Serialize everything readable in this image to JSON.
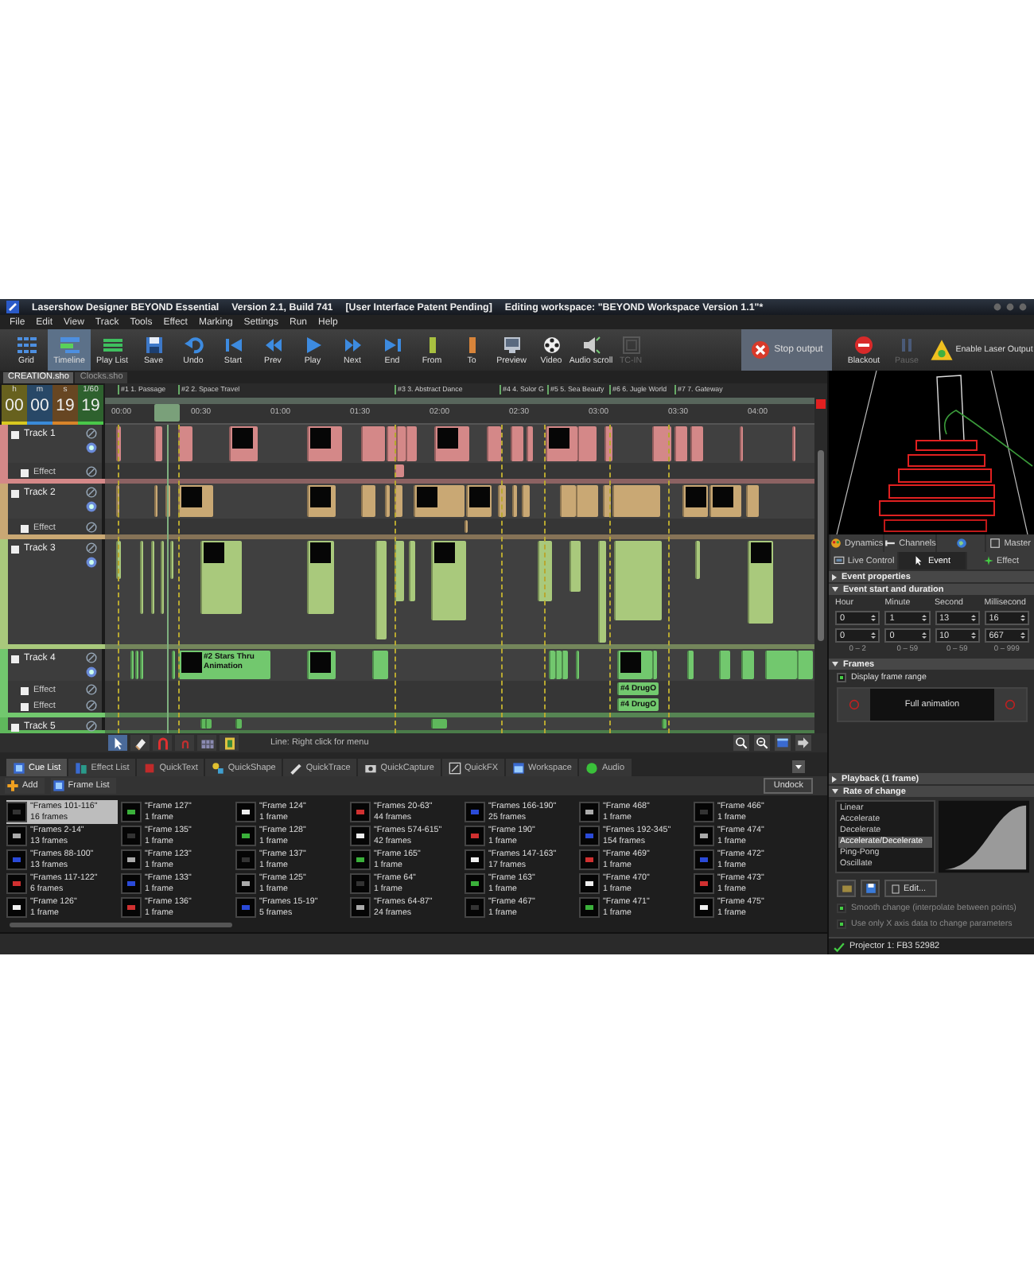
{
  "window": {
    "title": "Lasershow Designer BEYOND Essential",
    "version": "Version 2.1, Build 741",
    "patent": "[User Interface Patent Pending]",
    "workspace": "Editing workspace: \"BEYOND Workspace Version 1.1\"*"
  },
  "menu": [
    "File",
    "Edit",
    "View",
    "Track",
    "Tools",
    "Effect",
    "Marking",
    "Settings",
    "Run",
    "Help"
  ],
  "toolbar": {
    "views": [
      {
        "label": "Grid",
        "selected": false
      },
      {
        "label": "Timeline",
        "selected": true
      },
      {
        "label": "Play List",
        "selected": false
      }
    ],
    "commands": [
      {
        "label": "Save",
        "disabled": false
      },
      {
        "label": "Undo",
        "disabled": false
      },
      {
        "label": "Start",
        "disabled": false
      },
      {
        "label": "Prev",
        "disabled": false
      },
      {
        "label": "Play",
        "disabled": false
      },
      {
        "label": "Next",
        "disabled": false
      },
      {
        "label": "End",
        "disabled": false
      },
      {
        "label": "From",
        "disabled": false
      },
      {
        "label": "To",
        "disabled": false
      },
      {
        "label": "Preview",
        "disabled": false
      },
      {
        "label": "Video",
        "disabled": false
      },
      {
        "label": "Audio scroll",
        "disabled": false
      },
      {
        "label": "TC-IN",
        "disabled": true
      }
    ],
    "output": [
      {
        "kind": "stop",
        "label": "Stop output",
        "disabled": false
      },
      {
        "kind": "blackout",
        "label": "Blackout",
        "disabled": false
      },
      {
        "kind": "pause",
        "label": "Pause",
        "disabled": true
      },
      {
        "kind": "enable",
        "label": "Enable Laser Output",
        "disabled": false
      }
    ]
  },
  "file_tabs": [
    {
      "label": "CREATION.sho",
      "selected": true
    },
    {
      "label": "Clocks.sho",
      "selected": false
    }
  ],
  "timecode": [
    {
      "unit": "h",
      "value": "00",
      "color": "#d8c820"
    },
    {
      "unit": "m",
      "value": "00",
      "color": "#3a8ad8"
    },
    {
      "unit": "s",
      "value": "19",
      "color": "#d8842a"
    },
    {
      "unit": "1/60",
      "value": "19",
      "color": "#4ac84a"
    }
  ],
  "markers": [
    "#1 1. Passage",
    "#2 2. Space Travel",
    "#3 3. Abstract Dance",
    "#4 4. Solor G",
    "#5 5. Sea Beauty",
    "#6 6. Jugle World",
    "#7 7. Gateway"
  ],
  "ruler": [
    "00:00",
    "00:30",
    "01:00",
    "01:30",
    "02:00",
    "02:30",
    "03:00",
    "03:30",
    "04:00"
  ],
  "tracks": [
    {
      "name": "Track 1",
      "color": "#d48888",
      "effects": [
        {
          "name": "Effect"
        }
      ]
    },
    {
      "name": "Track 2",
      "color": "#c9a874",
      "effects": [
        {
          "name": "Effect"
        }
      ]
    },
    {
      "name": "Track 3",
      "color": "#a9c97c"
    },
    {
      "name": "Track 4",
      "color": "#72c86e",
      "clips": [
        {
          "label": "#2 Stars Thru Animation"
        }
      ],
      "effects": [
        {
          "name": "Effect",
          "clips": [
            {
              "label": "#4 DrugO"
            }
          ]
        },
        {
          "name": "Effect",
          "clips": [
            {
              "label": "#4 DrugO"
            }
          ]
        }
      ]
    },
    {
      "name": "Track 5",
      "color": "#5fb85c"
    }
  ],
  "timeline_tools": [
    {
      "selected": true
    },
    {
      "selected": false
    },
    {
      "selected": false
    },
    {
      "selected": false
    },
    {
      "selected": false
    },
    {
      "selected": false
    }
  ],
  "timeline_status": "Line: Right click for menu",
  "cue_panel": {
    "tabs": [
      {
        "label": "Cue List",
        "selected": true
      },
      {
        "label": "Effect List",
        "selected": false
      },
      {
        "label": "QuickText",
        "selected": false
      },
      {
        "label": "QuickShape",
        "selected": false
      },
      {
        "label": "QuickTrace",
        "selected": false
      },
      {
        "label": "QuickCapture",
        "selected": false
      },
      {
        "label": "QuickFX",
        "selected": false
      },
      {
        "label": "Workspace",
        "selected": false
      },
      {
        "label": "Audio",
        "selected": false
      }
    ],
    "actions": [
      "Add",
      "Frame List"
    ],
    "undock": "Undock",
    "cues": [
      {
        "name": "\"Frames 101-116\"",
        "frames": "16 frames",
        "selected": true
      },
      {
        "name": "\"Frames 2-14\"",
        "frames": "13 frames",
        "selected": false
      },
      {
        "name": "\"Frames 88-100\"",
        "frames": "13 frames",
        "selected": false
      },
      {
        "name": "\"Frames 117-122\"",
        "frames": "6 frames",
        "selected": false
      },
      {
        "name": "\"Frame 126\"",
        "frames": "1 frame",
        "selected": false
      },
      {
        "name": "\"Frame 127\"",
        "frames": "1 frame",
        "selected": false
      },
      {
        "name": "\"Frame 135\"",
        "frames": "1 frame",
        "selected": false
      },
      {
        "name": "\"Frame 123\"",
        "frames": "1 frame",
        "selected": false
      },
      {
        "name": "\"Frame 133\"",
        "frames": "1 frame",
        "selected": false
      },
      {
        "name": "\"Frame 136\"",
        "frames": "1 frame",
        "selected": false
      },
      {
        "name": "\"Frame 124\"",
        "frames": "1 frame",
        "selected": false
      },
      {
        "name": "\"Frame 128\"",
        "frames": "1 frame",
        "selected": false
      },
      {
        "name": "\"Frame 137\"",
        "frames": "1 frame",
        "selected": false
      },
      {
        "name": "\"Frame 125\"",
        "frames": "1 frame",
        "selected": false
      },
      {
        "name": "\"Frames 15-19\"",
        "frames": "5 frames",
        "selected": false
      },
      {
        "name": "\"Frames 20-63\"",
        "frames": "44 frames",
        "selected": false
      },
      {
        "name": "\"Frames 574-615\"",
        "frames": "42 frames",
        "selected": false
      },
      {
        "name": "\"Frame 165\"",
        "frames": "1 frame",
        "selected": false
      },
      {
        "name": "\"Frame 64\"",
        "frames": "1 frame",
        "selected": false
      },
      {
        "name": "\"Frames 64-87\"",
        "frames": "24 frames",
        "selected": false
      },
      {
        "name": "\"Frames 166-190\"",
        "frames": "25 frames",
        "selected": false
      },
      {
        "name": "\"Frame 190\"",
        "frames": "1 frame",
        "selected": false
      },
      {
        "name": "\"Frames 147-163\"",
        "frames": "17 frames",
        "selected": false
      },
      {
        "name": "\"Frame 163\"",
        "frames": "1 frame",
        "selected": false
      },
      {
        "name": "\"Frame 467\"",
        "frames": "1 frame",
        "selected": false
      },
      {
        "name": "\"Frame 468\"",
        "frames": "1 frame",
        "selected": false
      },
      {
        "name": "\"Frames 192-345\"",
        "frames": "154 frames",
        "selected": false
      },
      {
        "name": "\"Frame 469\"",
        "frames": "1 frame",
        "selected": false
      },
      {
        "name": "\"Frame 470\"",
        "frames": "1 frame",
        "selected": false
      },
      {
        "name": "\"Frame 471\"",
        "frames": "1 frame",
        "selected": false
      },
      {
        "name": "\"Frame 466\"",
        "frames": "1 frame",
        "selected": false
      },
      {
        "name": "\"Frame 474\"",
        "frames": "1 frame",
        "selected": false
      },
      {
        "name": "\"Frame 472\"",
        "frames": "1 frame",
        "selected": false
      },
      {
        "name": "\"Frame 473\"",
        "frames": "1 frame",
        "selected": false
      },
      {
        "name": "\"Frame 475\"",
        "frames": "1 frame",
        "selected": false
      }
    ]
  },
  "properties": {
    "top_tabs": [
      {
        "label": "Dynamics",
        "selected": false
      },
      {
        "label": "Channels",
        "selected": false
      },
      {
        "selected": false
      },
      {
        "label": "Master",
        "selected": false
      }
    ],
    "tabs": [
      {
        "label": "Live Control",
        "selected": false
      },
      {
        "label": "Event",
        "selected": true
      },
      {
        "label": "Effect",
        "selected": false
      }
    ],
    "event_properties": {
      "title": "Event properties",
      "expanded": false
    },
    "start_duration": {
      "title": "Event start and duration",
      "expanded": true,
      "columns": [
        "Hour",
        "Minute",
        "Second",
        "Millisecond"
      ],
      "start": [
        "0",
        "1",
        "13",
        "16"
      ],
      "duration": [
        "0",
        "0",
        "10",
        "667"
      ],
      "ranges": [
        "0 – 2",
        "0 – 59",
        "0 – 59",
        "0 – 999"
      ]
    },
    "frames": {
      "title": "Frames",
      "expanded": true,
      "display_range": {
        "label": "Display frame range",
        "checked": true
      },
      "range": "Full animation"
    },
    "playback": {
      "title": "Playback (1 frame)",
      "expanded": false
    },
    "rate": {
      "title": "Rate of change",
      "expanded": true,
      "options": [
        {
          "label": "Linear",
          "selected": false
        },
        {
          "label": "Accelerate",
          "selected": false
        },
        {
          "label": "Decelerate",
          "selected": false
        },
        {
          "label": "Accelerate/Decelerate",
          "selected": true
        },
        {
          "label": "Ping-Pong",
          "selected": false
        },
        {
          "label": "Oscillate",
          "selected": false
        }
      ],
      "edit": "Edit...",
      "options_checks": [
        {
          "label": "Smooth change (interpolate between points)",
          "checked": true,
          "disabled": true
        },
        {
          "label": "Use only X axis data to change parameters",
          "checked": true,
          "disabled": true
        }
      ]
    }
  },
  "status": "Projector 1: FB3 52982"
}
